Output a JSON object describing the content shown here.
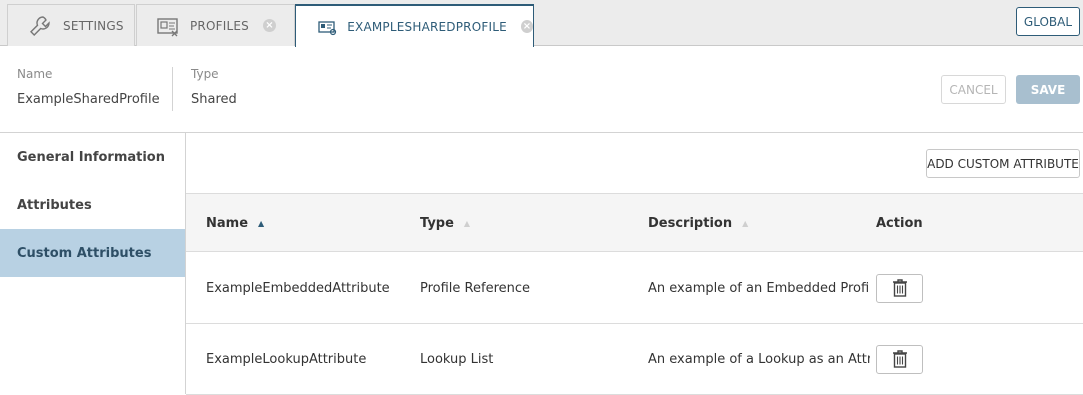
{
  "tabs": [
    {
      "label": "SETTINGS",
      "icon": "wrench-icon"
    },
    {
      "label": "PROFILES",
      "icon": "profiles-icon"
    },
    {
      "label": "EXAMPLESHAREDPROFILE",
      "icon": "shared-profile-icon"
    }
  ],
  "global_button": "GLOBAL",
  "header": {
    "name_label": "Name",
    "name_value": "ExampleSharedProfile",
    "type_label": "Type",
    "type_value": "Shared",
    "cancel_label": "CANCEL",
    "save_label": "SAVE"
  },
  "sidebar": {
    "items": [
      {
        "label": "General Information"
      },
      {
        "label": "Attributes"
      },
      {
        "label": "Custom Attributes",
        "active": true
      }
    ]
  },
  "main": {
    "add_button": "ADD CUSTOM ATTRIBUTE",
    "columns": [
      "Name",
      "Type",
      "Description",
      "Action"
    ],
    "sorted_column": "Name",
    "rows": [
      {
        "name": "ExampleEmbeddedAttribute",
        "type": "Profile Reference",
        "description": "An example of an Embedded Profi..."
      },
      {
        "name": "ExampleLookupAttribute",
        "type": "Lookup List",
        "description": "An example of a Lookup as an Attr..."
      }
    ]
  },
  "colors": {
    "accent": "#2e5c78",
    "active_nav": "#b8d1e3",
    "save_disabled": "#a8bfcf"
  }
}
